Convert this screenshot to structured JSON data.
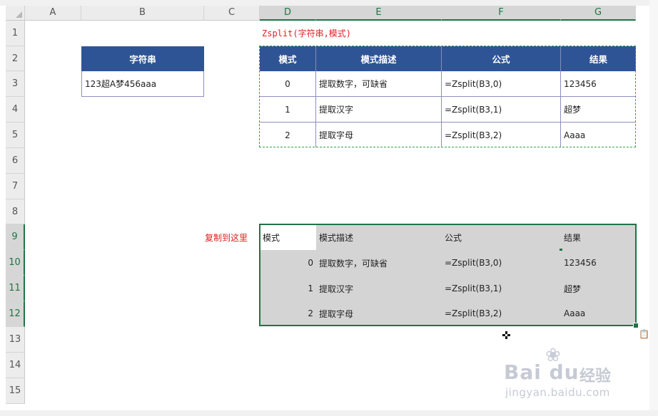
{
  "columns": [
    "A",
    "B",
    "C",
    "D",
    "E",
    "F",
    "G"
  ],
  "rows": [
    "1",
    "2",
    "3",
    "4",
    "5",
    "6",
    "7",
    "8",
    "9",
    "10",
    "11",
    "12",
    "13",
    "14",
    "15"
  ],
  "formula_title": "Zsplit(字符串,模式)",
  "paste_note": "复制到这里",
  "input_table": {
    "header": "字符串",
    "value": "123超A梦456aaa"
  },
  "ref_table": {
    "headers": [
      "模式",
      "模式描述",
      "公式",
      "结果"
    ],
    "rows": [
      [
        "0",
        "提取数字，可缺省",
        "=Zsplit(B3,0)",
        "123456"
      ],
      [
        "1",
        "提取汉字",
        "=Zsplit(B3,1)",
        "超梦"
      ],
      [
        "2",
        "提取字母",
        "=Zsplit(B3,2)",
        "Aaaa"
      ]
    ]
  },
  "pasted_table": {
    "headers": [
      "模式",
      "模式描述",
      "公式",
      "结果"
    ],
    "rows": [
      [
        "0",
        "提取数字，可缺省",
        "=Zsplit(B3,0)",
        "123456"
      ],
      [
        "1",
        "提取汉字",
        "=Zsplit(B3,1)",
        "超梦"
      ],
      [
        "2",
        "提取字母",
        "=Zsplit(B3,2)",
        "Aaaa"
      ]
    ]
  },
  "icons": {
    "corner": "select-all-triangle",
    "paste_options": "clipboard-icon",
    "cursor": "move-cursor-icon"
  },
  "watermark": {
    "logo": "Bai du",
    "cn": "经验",
    "url": "jingyan.baidu.com"
  },
  "colors": {
    "header_blue": "#2f5496",
    "excel_green": "#217346",
    "red_text": "#e02020",
    "paste_gray": "#d4d4d4"
  }
}
